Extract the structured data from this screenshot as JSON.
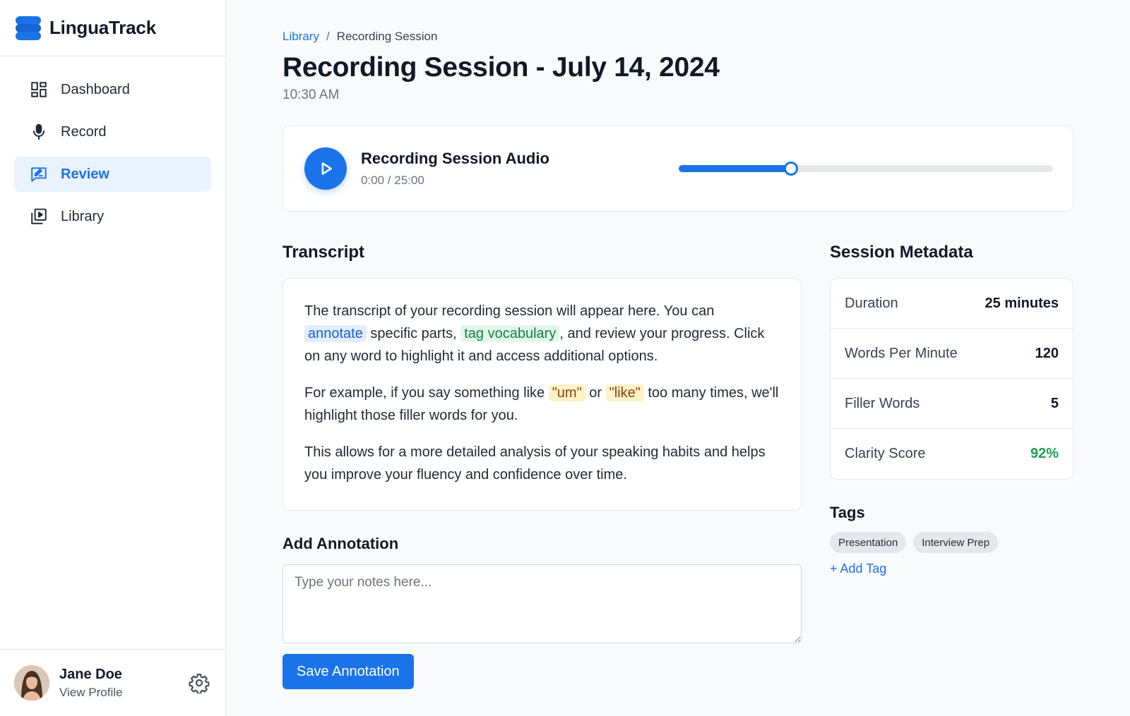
{
  "app": {
    "name": "LinguaTrack",
    "brand_color": "#1a73e8"
  },
  "sidebar": {
    "items": [
      {
        "label": "Dashboard",
        "icon": "dashboard-icon",
        "active": false
      },
      {
        "label": "Record",
        "icon": "microphone-icon",
        "active": false
      },
      {
        "label": "Review",
        "icon": "review-icon",
        "active": true
      },
      {
        "label": "Library",
        "icon": "library-icon",
        "active": false
      }
    ],
    "profile": {
      "name": "Jane Doe",
      "link": "View Profile"
    }
  },
  "breadcrumb": {
    "parent": "Library",
    "separator": "/",
    "current": "Recording Session"
  },
  "page": {
    "title": "Recording Session - July 14, 2024",
    "subtitle": "10:30 AM"
  },
  "player": {
    "title": "Recording Session Audio",
    "time": "0:00 / 25:00",
    "progress_percent": 30
  },
  "transcript": {
    "title": "Transcript",
    "p1_before": "The transcript of your recording session will appear here. You can ",
    "p1_hl1": "annotate",
    "p1_mid": " specific parts, ",
    "p1_hl2": "tag vocabulary",
    "p1_after": ", and review your progress. Click on any word to highlight it and access additional options.",
    "p2_before": "For example, if you say something like ",
    "p2_hl1": "\"um\"",
    "p2_mid": " or ",
    "p2_hl2": "\"like\"",
    "p2_after": " too many times, we'll highlight those filler words for you.",
    "p3": "This allows for a more detailed analysis of your speaking habits and helps you improve your fluency and confidence over time."
  },
  "annotation": {
    "title": "Add Annotation",
    "placeholder": "Type your notes here...",
    "save_label": "Save Annotation"
  },
  "metadata": {
    "title": "Session Metadata",
    "rows": [
      {
        "label": "Duration",
        "value": "25 minutes"
      },
      {
        "label": "Words Per Minute",
        "value": "120"
      },
      {
        "label": "Filler Words",
        "value": "5"
      },
      {
        "label": "Clarity Score",
        "value": "92%",
        "color": "#16a34a"
      }
    ]
  },
  "tags": {
    "title": "Tags",
    "items": [
      "Presentation",
      "Interview Prep"
    ],
    "add_label": "+ Add Tag"
  }
}
